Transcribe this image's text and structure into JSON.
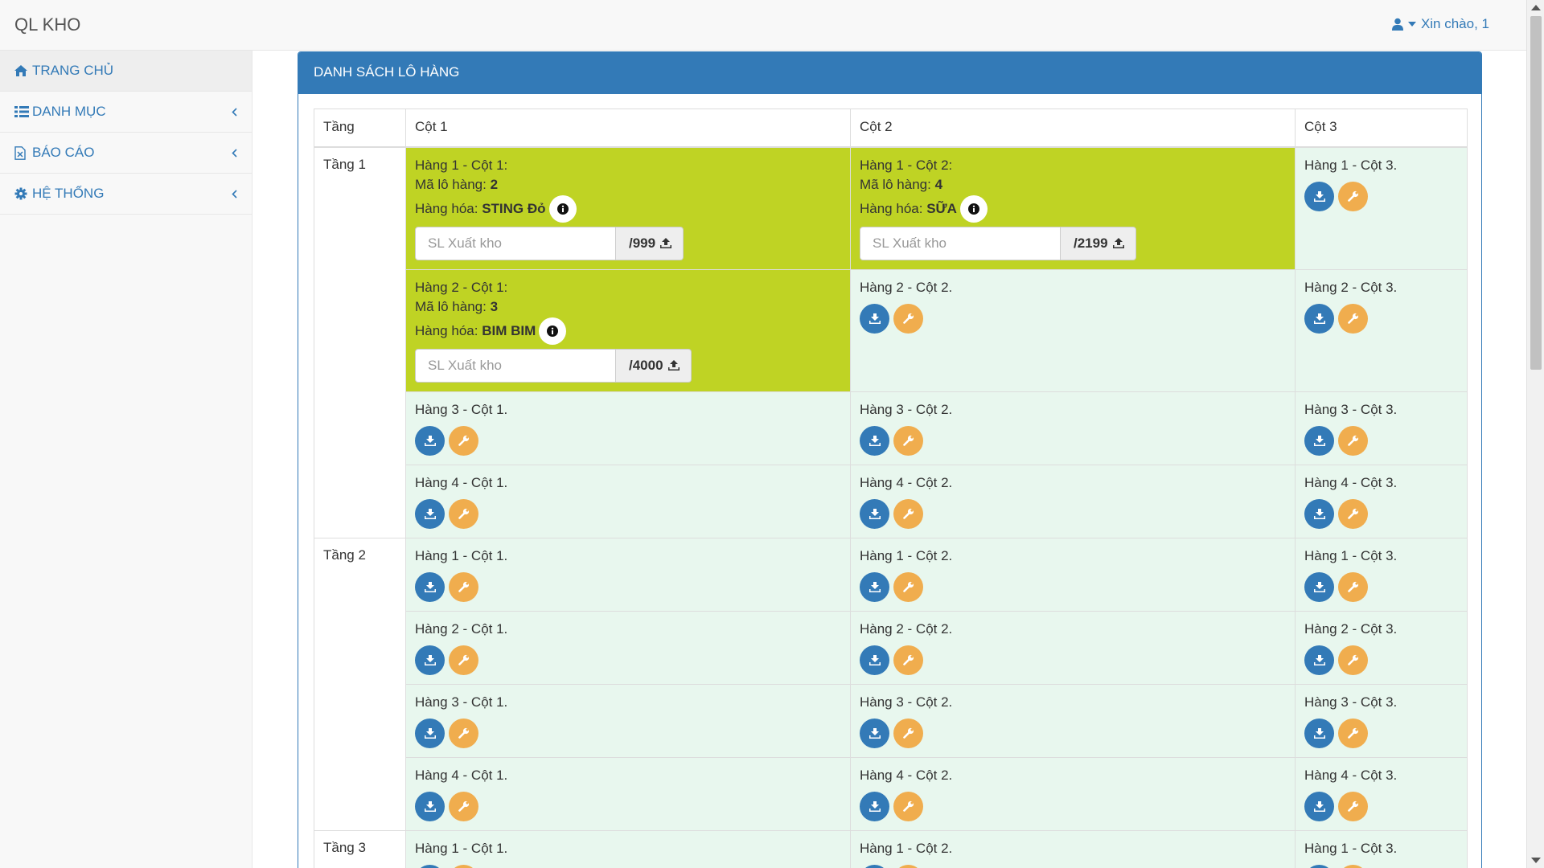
{
  "app": {
    "brand": "QL KHO",
    "user_greeting": "Xin chào, 1"
  },
  "sidebar": {
    "items": [
      {
        "label": "TRANG CHỦ",
        "icon": "home-icon",
        "has_submenu": false,
        "active": true
      },
      {
        "label": "DANH MỤC",
        "icon": "list-icon",
        "has_submenu": true
      },
      {
        "label": "BÁO CÁO",
        "icon": "file-excel-icon",
        "has_submenu": true
      },
      {
        "label": "HỆ THỐNG",
        "icon": "gear-icon",
        "has_submenu": true
      }
    ]
  },
  "panel": {
    "title": "DANH SÁCH LÔ HÀNG"
  },
  "table": {
    "headers": [
      "Tầng",
      "Cột 1",
      "Cột 2",
      "Cột 3"
    ],
    "lot_label": "Mã lô hàng:",
    "goods_label": "Hàng hóa:",
    "export_placeholder": "SL Xuất kho",
    "tiers": [
      {
        "label": "Tầng 1",
        "rows": [
          {
            "cells": [
              {
                "title": "Hàng 1 - Cột 1:",
                "lot": "2",
                "goods": "STING Đỏ",
                "max": "/999"
              },
              {
                "title": "Hàng 1 - Cột 2:",
                "lot": "4",
                "goods": "SỮA",
                "max": "/2199"
              },
              {
                "title": "Hàng 1 - Cột 3."
              }
            ]
          },
          {
            "cells": [
              {
                "title": "Hàng 2 - Cột 1:",
                "lot": "3",
                "goods": "BIM BIM",
                "max": "/4000"
              },
              {
                "title": "Hàng 2 - Cột 2."
              },
              {
                "title": "Hàng 2 - Cột 3."
              }
            ]
          },
          {
            "cells": [
              {
                "title": "Hàng 3 - Cột 1."
              },
              {
                "title": "Hàng 3 - Cột 2."
              },
              {
                "title": "Hàng 3 - Cột 3."
              }
            ]
          },
          {
            "cells": [
              {
                "title": "Hàng 4 - Cột 1."
              },
              {
                "title": "Hàng 4 - Cột 2."
              },
              {
                "title": "Hàng 4 - Cột 3."
              }
            ]
          }
        ]
      },
      {
        "label": "Tầng 2",
        "rows": [
          {
            "cells": [
              {
                "title": "Hàng 1 - Cột 1."
              },
              {
                "title": "Hàng 1 - Cột 2."
              },
              {
                "title": "Hàng 1 - Cột 3."
              }
            ]
          },
          {
            "cells": [
              {
                "title": "Hàng 2 - Cột 1."
              },
              {
                "title": "Hàng 2 - Cột 2."
              },
              {
                "title": "Hàng 2 - Cột 3."
              }
            ]
          },
          {
            "cells": [
              {
                "title": "Hàng 3 - Cột 1."
              },
              {
                "title": "Hàng 3 - Cột 2."
              },
              {
                "title": "Hàng 3 - Cột 3."
              }
            ]
          },
          {
            "cells": [
              {
                "title": "Hàng 4 - Cột 1."
              },
              {
                "title": "Hàng 4 - Cột 2."
              },
              {
                "title": "Hàng 4 - Cột 3."
              }
            ]
          }
        ]
      },
      {
        "label": "Tầng 3",
        "rows": [
          {
            "cells": [
              {
                "title": "Hàng 1 - Cột 1."
              },
              {
                "title": "Hàng 1 - Cột 2."
              },
              {
                "title": "Hàng 1 - Cột 3."
              }
            ]
          }
        ]
      }
    ]
  },
  "colors": {
    "primary": "#337ab7",
    "filled_cell": "#bfd324",
    "empty_cell": "#e8f7ee",
    "action_orange": "#f0ad4e"
  }
}
